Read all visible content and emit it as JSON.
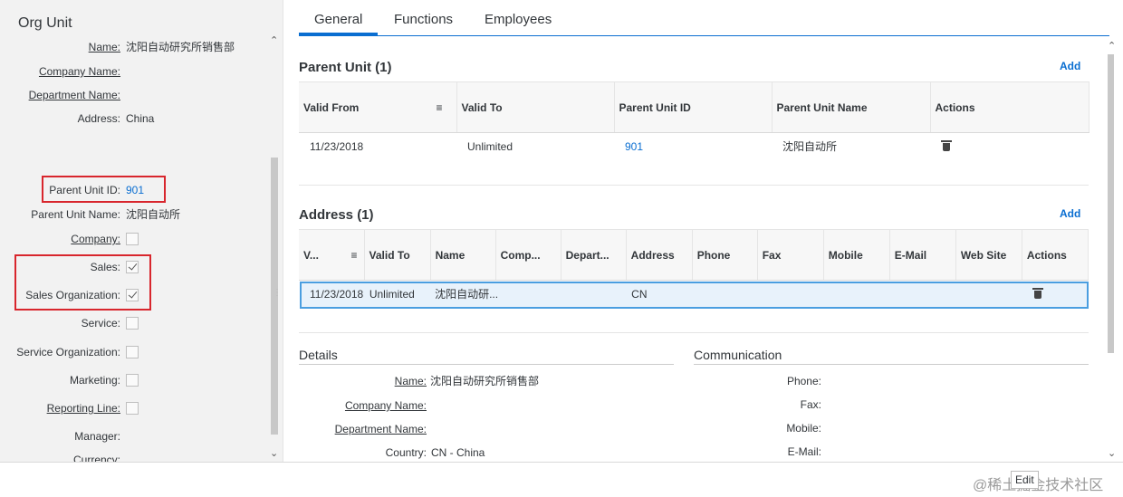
{
  "left": {
    "title": "Org Unit",
    "fields": {
      "name": {
        "label": "Name:",
        "value": "沈阳自动研究所销售部"
      },
      "company_name": {
        "label": "Company Name:"
      },
      "department_name": {
        "label": "Department Name:"
      },
      "address": {
        "label": "Address:",
        "value": "China"
      },
      "parent_unit_id": {
        "label": "Parent Unit ID:",
        "value": "901"
      },
      "parent_unit_name": {
        "label": "Parent Unit Name:",
        "value": "沈阳自动所"
      },
      "company": {
        "label": "Company:",
        "checked": false
      },
      "sales": {
        "label": "Sales:",
        "checked": true
      },
      "sales_org": {
        "label": "Sales Organization:",
        "checked": true
      },
      "service": {
        "label": "Service:",
        "checked": false
      },
      "service_org": {
        "label": "Service Organization:",
        "checked": false
      },
      "marketing": {
        "label": "Marketing:",
        "checked": false
      },
      "reporting_line": {
        "label": "Reporting Line:",
        "checked": false
      },
      "manager": {
        "label": "Manager:"
      },
      "currency": {
        "label": "Currency:"
      }
    }
  },
  "tabs": [
    "General",
    "Functions",
    "Employees"
  ],
  "parent_unit": {
    "title": "Parent Unit (1)",
    "add_label": "Add",
    "columns": [
      "Valid From",
      "Valid To",
      "Parent Unit ID",
      "Parent Unit Name",
      "Actions"
    ],
    "rows": [
      {
        "valid_from": "11/23/2018",
        "valid_to": "Unlimited",
        "parent_unit_id": "901",
        "parent_unit_name": "沈阳自动所"
      }
    ]
  },
  "address": {
    "title": "Address (1)",
    "add_label": "Add",
    "columns": [
      "V...",
      "Valid To",
      "Name",
      "Comp...",
      "Depart...",
      "Address",
      "Phone",
      "Fax",
      "Mobile",
      "E-Mail",
      "Web Site",
      "Actions"
    ],
    "rows": [
      {
        "valid_from": "11/23/2018",
        "valid_to": "Unlimited",
        "name": "沈阳自动研...",
        "address": "CN"
      }
    ]
  },
  "details": {
    "title": "Details",
    "name": {
      "label": "Name:",
      "value": "沈阳自动研究所销售部"
    },
    "company_name": {
      "label": "Company Name:"
    },
    "department_name": {
      "label": "Department Name:"
    },
    "country": {
      "label": "Country:",
      "value": "CN - China"
    }
  },
  "communication": {
    "title": "Communication",
    "phone": "Phone:",
    "fax": "Fax:",
    "mobile": "Mobile:",
    "email": "E-Mail:"
  },
  "footer": {
    "edit_label": "Edit",
    "watermark": "@稀土掘金技术社区"
  }
}
